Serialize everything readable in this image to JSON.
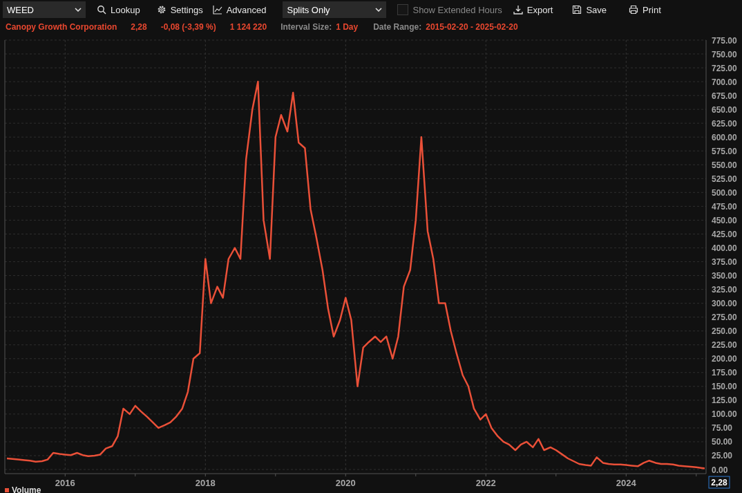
{
  "toolbar": {
    "symbol_field": {
      "value": "WEED"
    },
    "lookup_button": {
      "label": "Lookup"
    },
    "settings_button": {
      "label": "Settings"
    },
    "advanced_button": {
      "label": "Advanced"
    },
    "adjustment_dropdown": {
      "value": "Splits Only"
    },
    "extended_hours": {
      "label": "Show Extended Hours",
      "checked": false
    },
    "export_button": {
      "label": "Export"
    },
    "save_button": {
      "label": "Save"
    },
    "print_button": {
      "label": "Print"
    }
  },
  "quote": {
    "company": "Canopy Growth Corporation",
    "price": "2,28",
    "change": "-0,08 (-3,39 %)",
    "volume": "1 124 220",
    "interval_label": "Interval Size:",
    "interval_value": "1 Day",
    "range_label": "Date Range:",
    "range_value": "2015-02-20 - 2025-02-20"
  },
  "chart": {
    "last_price": "2,28",
    "volume_label": "Volume",
    "chart_data": {
      "type": "line",
      "grid": true,
      "xlim": [
        2015.14,
        2025.14
      ],
      "ylim": [
        0,
        775
      ],
      "x": [
        2015.17,
        2015.25,
        2015.33,
        2015.42,
        2015.5,
        2015.58,
        2015.67,
        2015.75,
        2015.83,
        2015.92,
        2016.0,
        2016.08,
        2016.17,
        2016.25,
        2016.33,
        2016.42,
        2016.5,
        2016.58,
        2016.67,
        2016.75,
        2016.83,
        2016.92,
        2017.0,
        2017.08,
        2017.17,
        2017.25,
        2017.33,
        2017.42,
        2017.5,
        2017.58,
        2017.67,
        2017.75,
        2017.83,
        2017.92,
        2018.0,
        2018.08,
        2018.17,
        2018.25,
        2018.33,
        2018.42,
        2018.5,
        2018.58,
        2018.67,
        2018.75,
        2018.83,
        2018.92,
        2019.0,
        2019.08,
        2019.17,
        2019.25,
        2019.33,
        2019.42,
        2019.5,
        2019.58,
        2019.67,
        2019.75,
        2019.83,
        2019.92,
        2020.0,
        2020.08,
        2020.17,
        2020.25,
        2020.33,
        2020.42,
        2020.5,
        2020.58,
        2020.67,
        2020.75,
        2020.83,
        2020.92,
        2021.0,
        2021.08,
        2021.17,
        2021.25,
        2021.33,
        2021.42,
        2021.5,
        2021.58,
        2021.67,
        2021.75,
        2021.83,
        2021.92,
        2022.0,
        2022.08,
        2022.17,
        2022.25,
        2022.33,
        2022.42,
        2022.5,
        2022.58,
        2022.67,
        2022.75,
        2022.83,
        2022.92,
        2023.0,
        2023.08,
        2023.17,
        2023.25,
        2023.33,
        2023.42,
        2023.5,
        2023.58,
        2023.67,
        2023.75,
        2023.83,
        2023.92,
        2024.0,
        2024.08,
        2024.17,
        2024.25,
        2024.33,
        2024.42,
        2024.5,
        2024.58,
        2024.67,
        2024.75,
        2024.83,
        2024.92,
        2025.0,
        2025.12
      ],
      "series": [
        {
          "color": "#ea5038",
          "values": [
            20,
            19,
            18,
            17,
            16,
            14,
            15,
            18,
            30,
            28,
            27,
            26,
            30,
            26,
            24,
            25,
            27,
            38,
            42,
            60,
            110,
            100,
            115,
            105,
            95,
            85,
            75,
            80,
            85,
            95,
            110,
            140,
            200,
            210,
            380,
            300,
            330,
            310,
            380,
            400,
            380,
            560,
            650,
            700,
            450,
            380,
            600,
            640,
            610,
            680,
            590,
            580,
            470,
            420,
            360,
            290,
            240,
            270,
            310,
            270,
            150,
            220,
            230,
            240,
            230,
            240,
            200,
            240,
            330,
            360,
            450,
            600,
            430,
            380,
            300,
            300,
            250,
            210,
            170,
            150,
            110,
            90,
            100,
            75,
            60,
            50,
            45,
            35,
            45,
            50,
            40,
            55,
            35,
            40,
            35,
            28,
            20,
            15,
            10,
            8,
            7,
            22,
            12,
            10,
            9,
            9,
            8,
            7,
            6,
            12,
            16,
            12,
            10,
            10,
            9,
            7,
            6,
            5,
            4,
            2
          ]
        }
      ],
      "xticks": [
        2016,
        2018,
        2020,
        2022,
        2024
      ],
      "yticks": [
        {
          "value": 0,
          "label": "0.00"
        },
        {
          "value": 25,
          "label": "25.00"
        },
        {
          "value": 50,
          "label": "50.00"
        },
        {
          "value": 75,
          "label": "75.00"
        },
        {
          "value": 100,
          "label": "100.00"
        },
        {
          "value": 125,
          "label": "125.00"
        },
        {
          "value": 150,
          "label": "150.00"
        },
        {
          "value": 175,
          "label": "175.00"
        },
        {
          "value": 200,
          "label": "200.00"
        },
        {
          "value": 225,
          "label": "225.00"
        },
        {
          "value": 250,
          "label": "250.00"
        },
        {
          "value": 275,
          "label": "275.00"
        },
        {
          "value": 300,
          "label": "300.00"
        },
        {
          "value": 325,
          "label": "325.00"
        },
        {
          "value": 350,
          "label": "350.00"
        },
        {
          "value": 375,
          "label": "375.00"
        },
        {
          "value": 400,
          "label": "400.00"
        },
        {
          "value": 425,
          "label": "425.00"
        },
        {
          "value": 450,
          "label": "450.00"
        },
        {
          "value": 475,
          "label": "475.00"
        },
        {
          "value": 500,
          "label": "500.00"
        },
        {
          "value": 525,
          "label": "525.00"
        },
        {
          "value": 550,
          "label": "550.00"
        },
        {
          "value": 575,
          "label": "575.00"
        },
        {
          "value": 600,
          "label": "600.00"
        },
        {
          "value": 625,
          "label": "625.00"
        },
        {
          "value": 650,
          "label": "650.00"
        },
        {
          "value": 675,
          "label": "675.00"
        },
        {
          "value": 700,
          "label": "700.00"
        },
        {
          "value": 725,
          "label": "725.00"
        },
        {
          "value": 750,
          "label": "750.00"
        },
        {
          "value": 775,
          "label": "775.00"
        }
      ]
    }
  }
}
